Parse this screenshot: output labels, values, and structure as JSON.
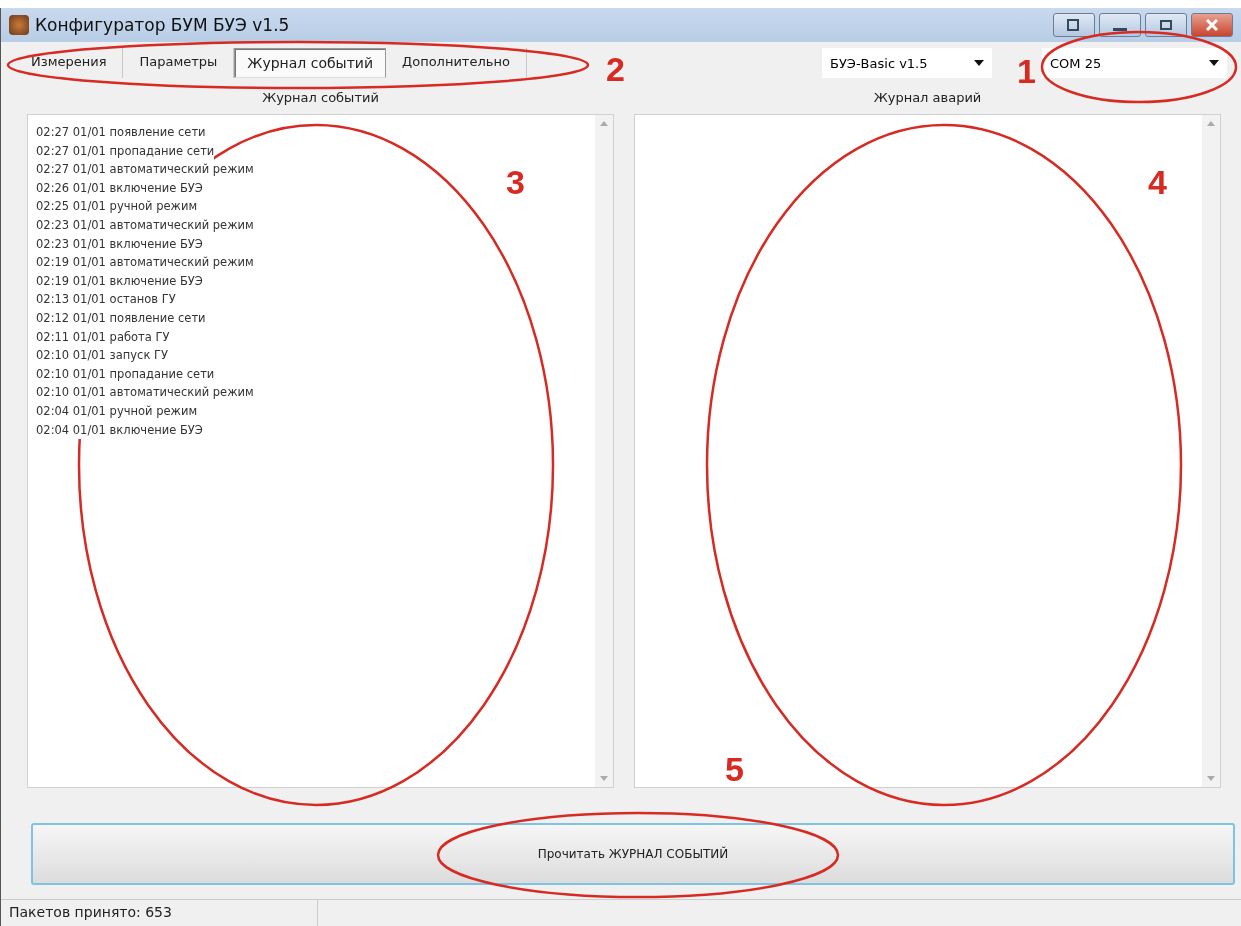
{
  "window": {
    "title": "Конфигуратор БУМ БУЭ v1.5"
  },
  "tabs": [
    {
      "label": "Измерения",
      "selected": false
    },
    {
      "label": "Параметры",
      "selected": false
    },
    {
      "label": "Журнал событий",
      "selected": true
    },
    {
      "label": "Дополнительно",
      "selected": false
    }
  ],
  "device_select": {
    "value": "БУЭ-Basic v1.5"
  },
  "port_select": {
    "value": "COM 25"
  },
  "event_log": {
    "title": "Журнал событий",
    "entries": [
      "02:27 01/01 появление сети",
      "02:27 01/01 пропадание сети",
      "02:27 01/01 автоматический режим",
      "02:26 01/01 включение БУЭ",
      "02:25 01/01 ручной режим",
      "02:23 01/01 автоматический режим",
      "02:23 01/01 включение БУЭ",
      "02:19 01/01 автоматический режим",
      "02:19 01/01 включение БУЭ",
      "02:13 01/01 останов ГУ",
      "02:12 01/01 появление сети",
      "02:11 01/01 работа ГУ",
      "02:10 01/01 запуск ГУ",
      "02:10 01/01 пропадание сети",
      "02:10 01/01 автоматический режим",
      "02:04 01/01 ручной режим",
      "02:04 01/01 включение БУЭ"
    ]
  },
  "alarm_log": {
    "title": "Журнал аварий"
  },
  "read_button": {
    "label": "Прочитать ЖУРНАЛ СОБЫТИЙ"
  },
  "status_bar": {
    "text": "Пакетов принято: 653"
  },
  "annotations": [
    {
      "number": "1"
    },
    {
      "number": "2"
    },
    {
      "number": "3"
    },
    {
      "number": "4"
    },
    {
      "number": "5"
    }
  ]
}
